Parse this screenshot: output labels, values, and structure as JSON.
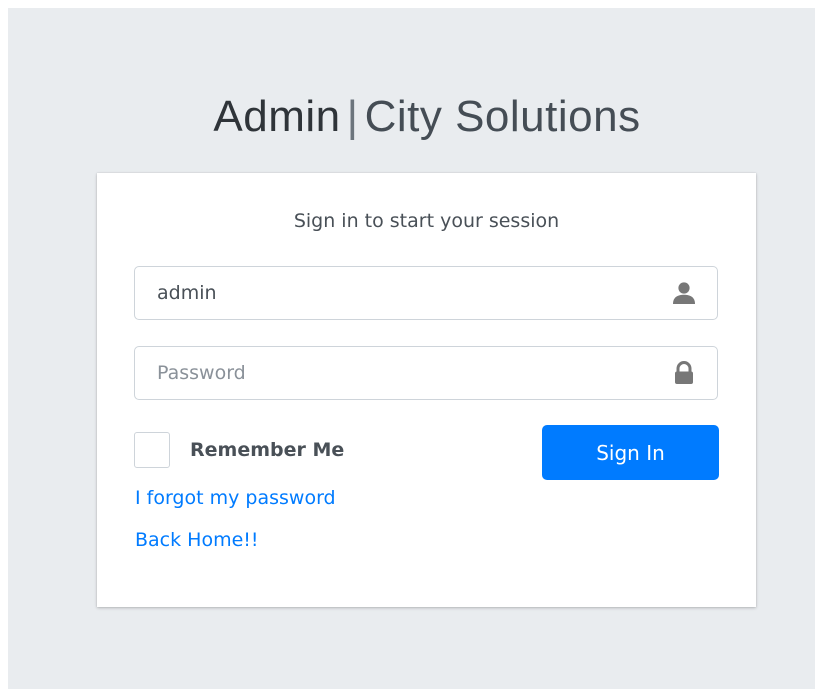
{
  "brand": {
    "strong": "Admin",
    "separator": "|",
    "light": "City Solutions"
  },
  "login": {
    "message": "Sign in to start your session",
    "username_value": "admin",
    "username_icon": "user-icon",
    "password_placeholder": "Password",
    "password_icon": "lock-icon",
    "remember_label": "Remember Me",
    "remember_checked": false,
    "signin_label": "Sign In",
    "forgot_link": "I forgot my password",
    "home_link": "Back Home!!"
  },
  "colors": {
    "background": "#e9ecef",
    "card": "#ffffff",
    "primary": "#007bff",
    "text": "#495057",
    "icon": "#777777"
  }
}
